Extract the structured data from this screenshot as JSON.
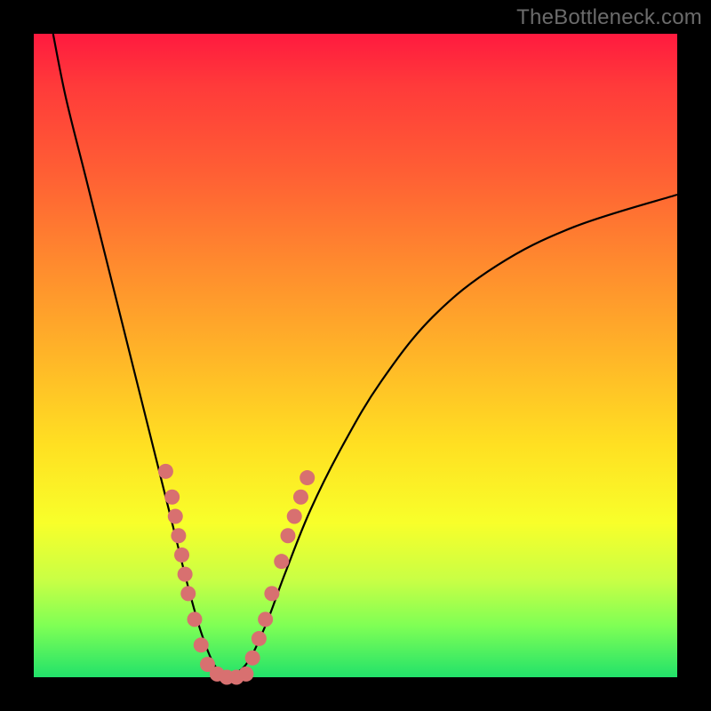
{
  "watermark": "TheBottleneck.com",
  "chart_data": {
    "type": "line",
    "title": "",
    "xlabel": "",
    "ylabel": "",
    "xlim": [
      0,
      100
    ],
    "ylim": [
      0,
      100
    ],
    "grid": false,
    "legend": false,
    "background_gradient": {
      "top": "#ff1a3f",
      "bottom": "#22e26a",
      "stops": [
        "#ff1a3f",
        "#ff6034",
        "#ffb528",
        "#ffe022",
        "#c8ff45",
        "#22e26a"
      ]
    },
    "series": [
      {
        "name": "left-curve",
        "type": "line",
        "color": "#000000",
        "points": [
          {
            "x": 3,
            "y": 100
          },
          {
            "x": 5,
            "y": 90
          },
          {
            "x": 8,
            "y": 78
          },
          {
            "x": 11,
            "y": 66
          },
          {
            "x": 14,
            "y": 54
          },
          {
            "x": 17,
            "y": 42
          },
          {
            "x": 20,
            "y": 30
          },
          {
            "x": 22,
            "y": 22
          },
          {
            "x": 24,
            "y": 14
          },
          {
            "x": 26,
            "y": 7
          },
          {
            "x": 28,
            "y": 2
          },
          {
            "x": 30,
            "y": 0
          }
        ]
      },
      {
        "name": "right-curve",
        "type": "line",
        "color": "#000000",
        "points": [
          {
            "x": 30,
            "y": 0
          },
          {
            "x": 33,
            "y": 2
          },
          {
            "x": 36,
            "y": 8
          },
          {
            "x": 39,
            "y": 16
          },
          {
            "x": 43,
            "y": 26
          },
          {
            "x": 48,
            "y": 36
          },
          {
            "x": 54,
            "y": 46
          },
          {
            "x": 62,
            "y": 56
          },
          {
            "x": 72,
            "y": 64
          },
          {
            "x": 84,
            "y": 70
          },
          {
            "x": 100,
            "y": 75
          }
        ]
      },
      {
        "name": "left-dots",
        "type": "scatter",
        "color": "#d87070",
        "points": [
          {
            "x": 20.5,
            "y": 32
          },
          {
            "x": 21.5,
            "y": 28
          },
          {
            "x": 22.0,
            "y": 25
          },
          {
            "x": 22.5,
            "y": 22
          },
          {
            "x": 23.0,
            "y": 19
          },
          {
            "x": 23.5,
            "y": 16
          },
          {
            "x": 24.0,
            "y": 13
          },
          {
            "x": 25.0,
            "y": 9
          },
          {
            "x": 26.0,
            "y": 5
          },
          {
            "x": 27.0,
            "y": 2
          },
          {
            "x": 28.5,
            "y": 0.5
          },
          {
            "x": 30.0,
            "y": 0
          },
          {
            "x": 31.5,
            "y": 0
          },
          {
            "x": 33.0,
            "y": 0.5
          }
        ]
      },
      {
        "name": "right-dots",
        "type": "scatter",
        "color": "#d87070",
        "points": [
          {
            "x": 34.0,
            "y": 3
          },
          {
            "x": 35.0,
            "y": 6
          },
          {
            "x": 36.0,
            "y": 9
          },
          {
            "x": 37.0,
            "y": 13
          },
          {
            "x": 38.5,
            "y": 18
          },
          {
            "x": 39.5,
            "y": 22
          },
          {
            "x": 40.5,
            "y": 25
          },
          {
            "x": 41.5,
            "y": 28
          },
          {
            "x": 42.5,
            "y": 31
          }
        ]
      }
    ]
  }
}
